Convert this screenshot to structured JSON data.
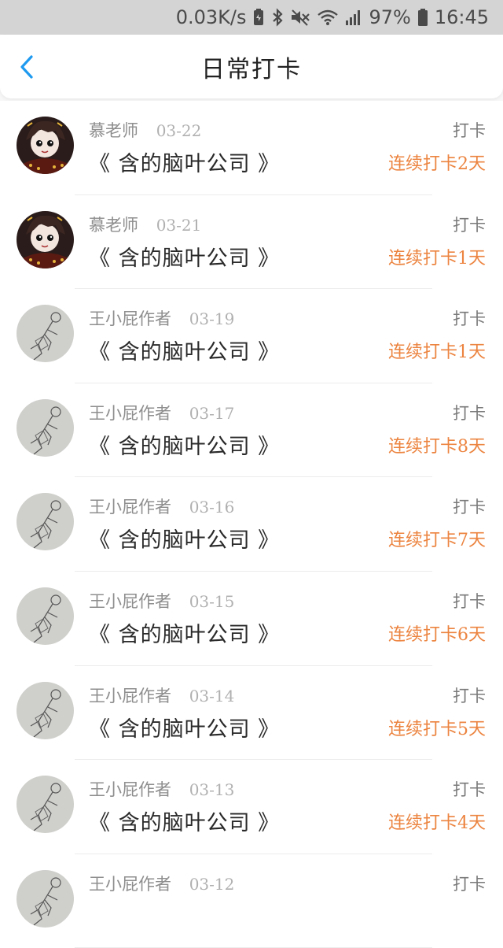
{
  "status_bar": {
    "network_speed": "0.03K/s",
    "battery_percent": "97%",
    "time": "16:45",
    "icons": [
      "battery-saver-icon",
      "bluetooth-icon",
      "mute-icon",
      "wifi-icon",
      "signal-icon",
      "battery-icon"
    ]
  },
  "header": {
    "title": "日常打卡",
    "back_icon": "chevron-left-icon"
  },
  "colors": {
    "accent": "#1e9af0",
    "streak": "#ec8440",
    "status_bar_bg": "#d4d4d4"
  },
  "checkins": [
    {
      "user": "慕老师",
      "date": "03-22",
      "title": "《 含的脑叶公司 》",
      "action": "打卡",
      "streak": "连续打卡2天",
      "avatar": "anime-avatar"
    },
    {
      "user": "慕老师",
      "date": "03-21",
      "title": "《 含的脑叶公司 》",
      "action": "打卡",
      "streak": "连续打卡1天",
      "avatar": "anime-avatar"
    },
    {
      "user": "王小屁作者",
      "date": "03-19",
      "title": "《 含的脑叶公司 》",
      "action": "打卡",
      "streak": "连续打卡1天",
      "avatar": "sketch-avatar"
    },
    {
      "user": "王小屁作者",
      "date": "03-17",
      "title": "《 含的脑叶公司 》",
      "action": "打卡",
      "streak": "连续打卡8天",
      "avatar": "sketch-avatar"
    },
    {
      "user": "王小屁作者",
      "date": "03-16",
      "title": "《 含的脑叶公司 》",
      "action": "打卡",
      "streak": "连续打卡7天",
      "avatar": "sketch-avatar"
    },
    {
      "user": "王小屁作者",
      "date": "03-15",
      "title": "《 含的脑叶公司 》",
      "action": "打卡",
      "streak": "连续打卡6天",
      "avatar": "sketch-avatar"
    },
    {
      "user": "王小屁作者",
      "date": "03-14",
      "title": "《 含的脑叶公司 》",
      "action": "打卡",
      "streak": "连续打卡5天",
      "avatar": "sketch-avatar"
    },
    {
      "user": "王小屁作者",
      "date": "03-13",
      "title": "《 含的脑叶公司 》",
      "action": "打卡",
      "streak": "连续打卡4天",
      "avatar": "sketch-avatar"
    },
    {
      "user": "王小屁作者",
      "date": "03-12",
      "title": "",
      "action": "打卡",
      "streak": "",
      "avatar": "sketch-avatar"
    }
  ]
}
